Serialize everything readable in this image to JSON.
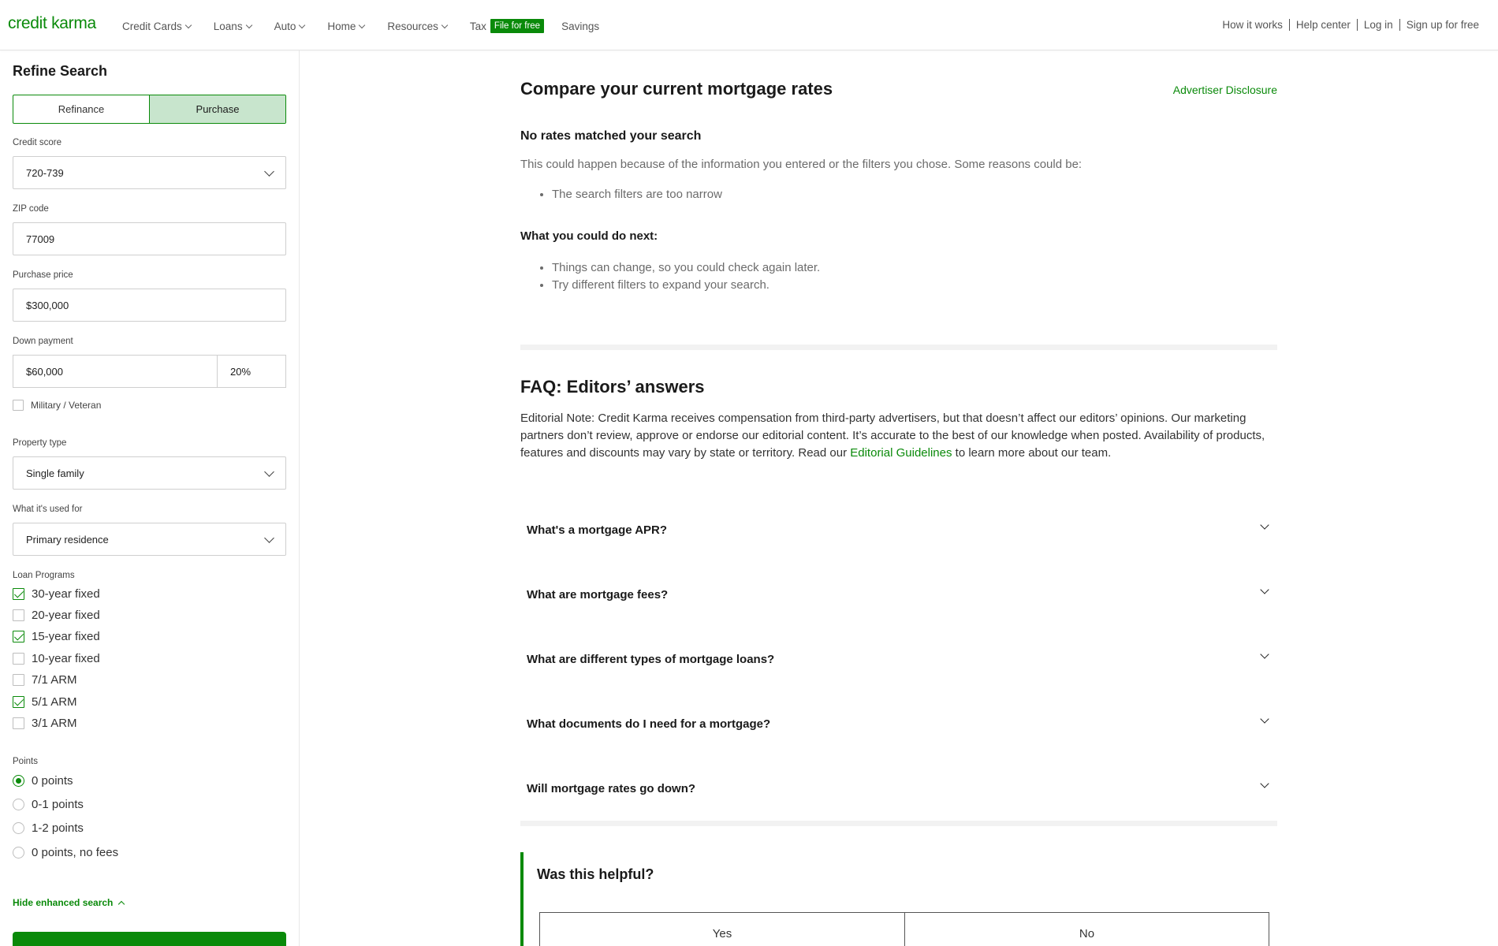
{
  "header": {
    "logo": "credit karma",
    "nav": [
      {
        "label": "Credit Cards",
        "dropdown": true
      },
      {
        "label": "Loans",
        "dropdown": true
      },
      {
        "label": "Auto",
        "dropdown": true
      },
      {
        "label": "Home",
        "dropdown": true
      },
      {
        "label": "Resources",
        "dropdown": true
      }
    ],
    "tax_label": "Tax",
    "tax_badge": "File for free",
    "savings_label": "Savings",
    "right_links": [
      "How it works",
      "Help center",
      "Log in",
      "Sign up for free"
    ]
  },
  "sidebar": {
    "title": "Refine Search",
    "toggle": {
      "refinance": "Refinance",
      "purchase": "Purchase",
      "selected": "Purchase"
    },
    "credit_score": {
      "label": "Credit score",
      "value": "720-739"
    },
    "zip": {
      "label": "ZIP code",
      "value": "77009"
    },
    "purchase_price": {
      "label": "Purchase price",
      "value": "$300,000"
    },
    "down_payment": {
      "label": "Down payment",
      "amount": "$60,000",
      "percent": "20%"
    },
    "military": {
      "label": "Military / Veteran",
      "checked": false
    },
    "property_type": {
      "label": "Property type",
      "value": "Single family"
    },
    "used_for": {
      "label": "What it's used for",
      "value": "Primary residence"
    },
    "loan_programs": {
      "label": "Loan Programs",
      "items": [
        {
          "label": "30-year fixed",
          "checked": true
        },
        {
          "label": "20-year fixed",
          "checked": false
        },
        {
          "label": "15-year fixed",
          "checked": true
        },
        {
          "label": "10-year fixed",
          "checked": false
        },
        {
          "label": "7/1 ARM",
          "checked": false
        },
        {
          "label": "5/1 ARM",
          "checked": true
        },
        {
          "label": "3/1 ARM",
          "checked": false
        }
      ]
    },
    "points": {
      "label": "Points",
      "items": [
        {
          "label": "0 points",
          "selected": true
        },
        {
          "label": "0-1 points",
          "selected": false
        },
        {
          "label": "1-2 points",
          "selected": false
        },
        {
          "label": "0 points, no fees",
          "selected": false
        }
      ]
    },
    "hide_enhanced": "Hide enhanced search"
  },
  "main": {
    "title": "Compare your current mortgage rates",
    "advertiser_disclosure": "Advertiser Disclosure",
    "no_rates_title": "No rates matched your search",
    "no_rates_text": "This could happen because of the information you entered or the filters you chose. Some reasons could be:",
    "reasons": [
      "The search filters are too narrow"
    ],
    "next_title": "What you could do next:",
    "next_items": [
      "Things can change, so you could check again later.",
      "Try different filters to expand your search."
    ],
    "faq_title": "FAQ: Editors’ answers",
    "editorial_before": "Editorial Note: Credit Karma receives compensation from third-party advertisers, but that doesn’t affect our editors’ opinions. Our marketing partners don’t review, approve or endorse our editorial content. It’s accurate to the best of our knowledge when posted. Availability of products, features and discounts may vary by state or territory. Read our ",
    "editorial_link": "Editorial Guidelines",
    "editorial_after": " to learn more about our team.",
    "faqs": [
      "What's a mortgage APR?",
      "What are mortgage fees?",
      "What are different types of mortgage loans?",
      "What documents do I need for a mortgage?",
      "Will mortgage rates go down?"
    ],
    "helpful": {
      "title": "Was this helpful?",
      "yes": "Yes",
      "no": "No"
    }
  },
  "colors": {
    "brand_green": "#0a8a0a",
    "selected_tab_bg": "#c8e5cd"
  }
}
